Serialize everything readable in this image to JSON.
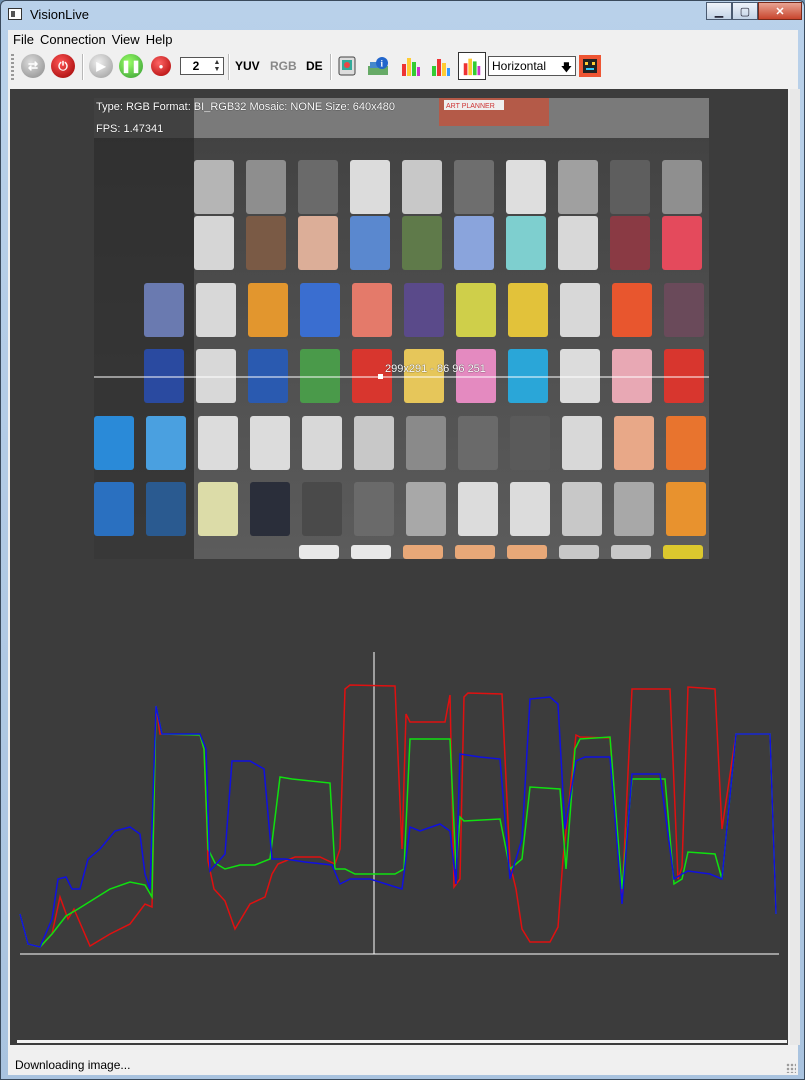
{
  "window": {
    "title": "VisionLive",
    "controls": {
      "minimize": "▁",
      "maximize": "▢",
      "close": "✕"
    }
  },
  "menu": [
    "File",
    "Connection",
    "View",
    "Help"
  ],
  "toolbar": {
    "spin_value": "2",
    "yuv_label": "YUV",
    "rgb_label": "RGB",
    "de_label": "DE",
    "orientation": "Horizontal",
    "icons": [
      "refresh-icon",
      "disconnect-plug-icon",
      "play-icon",
      "pause-icon",
      "record-icon",
      "display-icon",
      "info-icon",
      "histogram-icon",
      "histogram-alt-icon",
      "line-profile-icon",
      "error-face-icon"
    ]
  },
  "video": {
    "info_line": "Type: RGB Format: BI_RGB32 Mosaic: NONE Size: 640x480",
    "fps_line": "FPS: 1.47341",
    "cursor_readout": "299x291 - 86 96 251",
    "banner_text": "ART PLANNER"
  },
  "status": {
    "text": "Downloading image..."
  },
  "colors": {
    "accent_red": "#e01010",
    "accent_green": "#10e010",
    "accent_blue": "#1010e0",
    "panel_bg": "#3c3c3c"
  }
}
